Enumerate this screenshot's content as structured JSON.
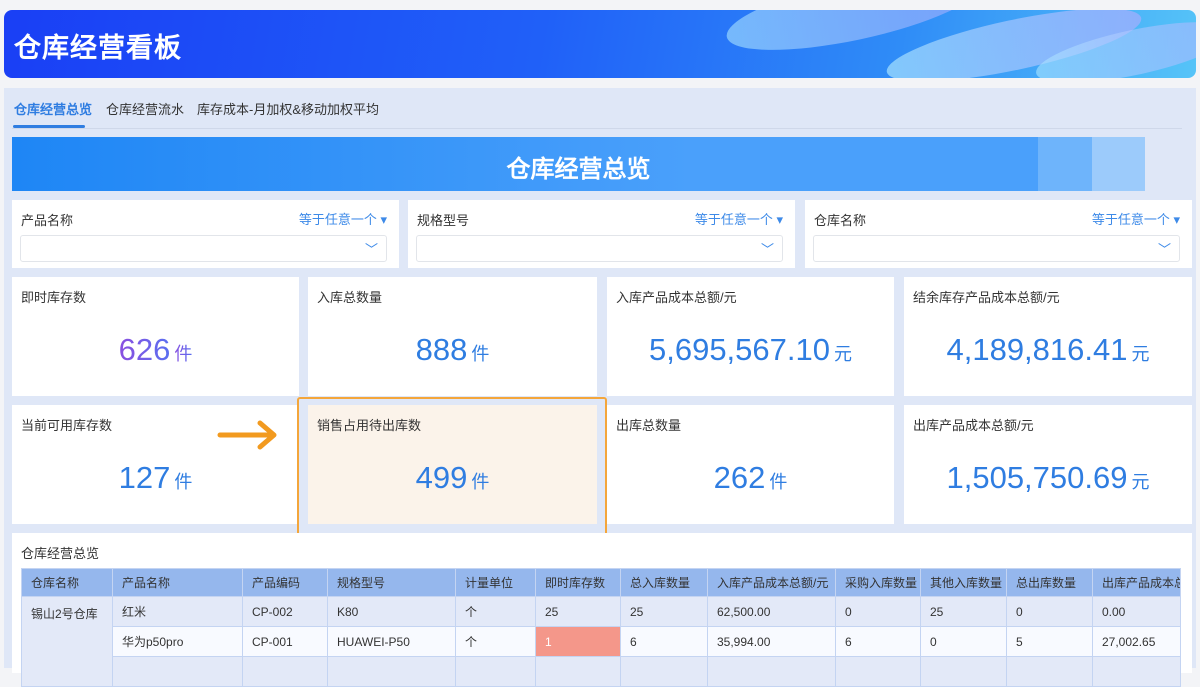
{
  "header": {
    "title": "仓库经营看板"
  },
  "tabs": [
    {
      "label": "仓库经营总览",
      "active": true
    },
    {
      "label": "仓库经营流水"
    },
    {
      "label": "库存成本-月加权&移动加权平均"
    }
  ],
  "banner": {
    "title": "仓库经营总览"
  },
  "filters": [
    {
      "label": "产品名称",
      "operator": "等于任意一个",
      "value": ""
    },
    {
      "label": "规格型号",
      "operator": "等于任意一个",
      "value": ""
    },
    {
      "label": "仓库名称",
      "operator": "等于任意一个",
      "value": ""
    }
  ],
  "kpis": [
    {
      "title": "即时库存数",
      "value": "626",
      "unit": "件"
    },
    {
      "title": "入库总数量",
      "value": "888",
      "unit": "件"
    },
    {
      "title": "入库产品成本总额/元",
      "value": "5,695,567.10",
      "unit": "元"
    },
    {
      "title": "结余库存产品成本总额/元",
      "value": "4,189,816.41",
      "unit": "元"
    },
    {
      "title": "当前可用库存数",
      "value": "127",
      "unit": "件"
    },
    {
      "title": "销售占用待出库数",
      "value": "499",
      "unit": "件"
    },
    {
      "title": "出库总数量",
      "value": "262",
      "unit": "件"
    },
    {
      "title": "出库产品成本总额/元",
      "value": "1,505,750.69",
      "unit": "元"
    }
  ],
  "table": {
    "title": "仓库经营总览",
    "columns": [
      "仓库名称",
      "产品名称",
      "产品编码",
      "规格型号",
      "计量单位",
      "即时库存数",
      "总入库数量",
      "入库产品成本总额/元",
      "采购入库数量",
      "其他入库数量",
      "总出库数量",
      "出库产品成本总额/元"
    ],
    "warehouse": "锡山2号仓库",
    "rows": [
      [
        "红米",
        "CP-002",
        "K80",
        "个",
        "25",
        "25",
        "62,500.00",
        "0",
        "25",
        "0",
        "0.00"
      ],
      [
        "华为p50pro",
        "CP-001",
        "HUAWEI-P50",
        "个",
        "1",
        "6",
        "35,994.00",
        "6",
        "0",
        "5",
        "27,002.65"
      ]
    ]
  },
  "colors": {
    "accent": "#2f7de1",
    "highlight": "#f4a63b",
    "warning": "#f4978a"
  }
}
